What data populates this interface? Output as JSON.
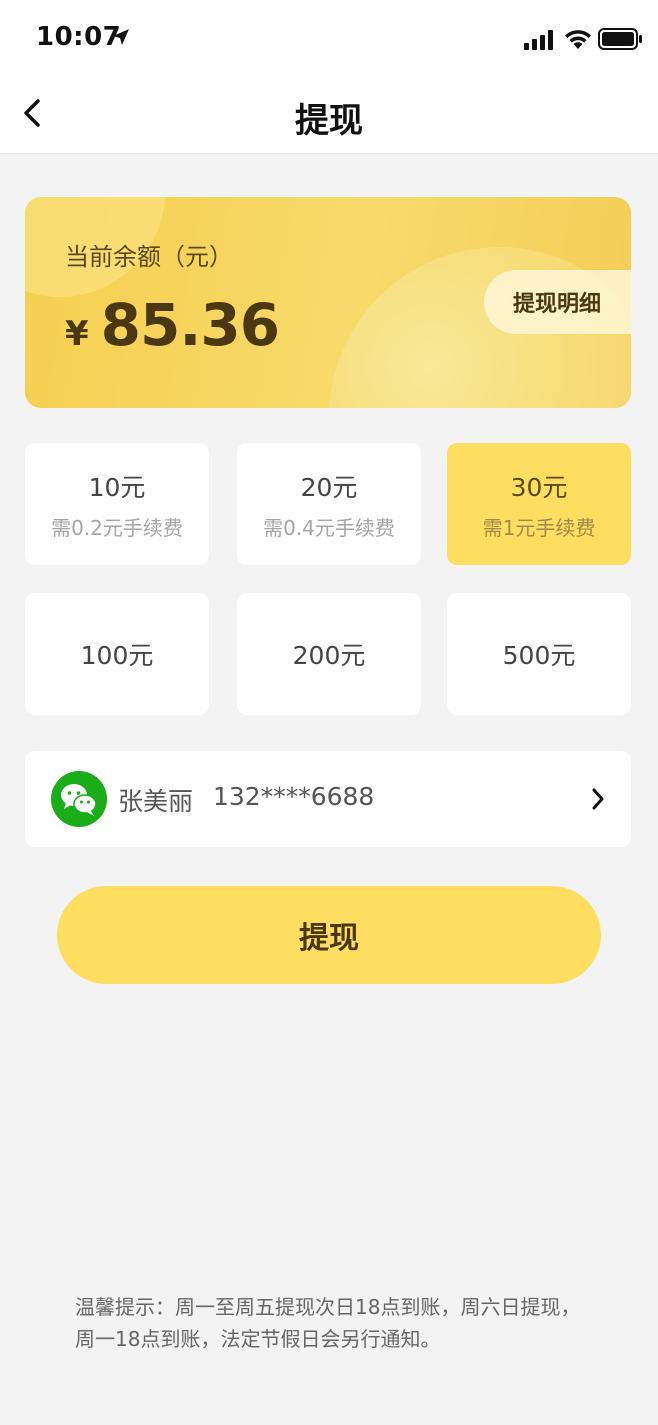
{
  "status_bar": {
    "time": "10:07",
    "icons": [
      "location-arrow-icon",
      "signal-icon",
      "wifi-icon",
      "battery-icon"
    ]
  },
  "nav": {
    "title": "提现",
    "back_icon": "chevron-left-icon"
  },
  "balance": {
    "label": "当前余额（元）",
    "currency": "¥",
    "amount": "85.36",
    "detail_link": "提现明细"
  },
  "options": [
    {
      "amount": "10元",
      "fee": "需0.2元手续费",
      "selected": false
    },
    {
      "amount": "20元",
      "fee": "需0.4元手续费",
      "selected": false
    },
    {
      "amount": "30元",
      "fee": "需1元手续费",
      "selected": true
    },
    {
      "amount": "100元",
      "fee": "",
      "selected": false
    },
    {
      "amount": "200元",
      "fee": "",
      "selected": false
    },
    {
      "amount": "500元",
      "fee": "",
      "selected": false
    }
  ],
  "account": {
    "icon": "wechat-icon",
    "name": "张美丽",
    "phone": "132****6688"
  },
  "withdraw_button": "提现",
  "tips": "温馨提示：周一至周五提现次日18点到账，周六日提现，周一18点到账，法定节假日会另行通知。",
  "colors": {
    "accent": "#fdde60",
    "card_gradient_start": "#f5cf4f",
    "background": "#f3f3f3",
    "text_dark": "#4b3812",
    "wechat_green": "#1aad19"
  }
}
